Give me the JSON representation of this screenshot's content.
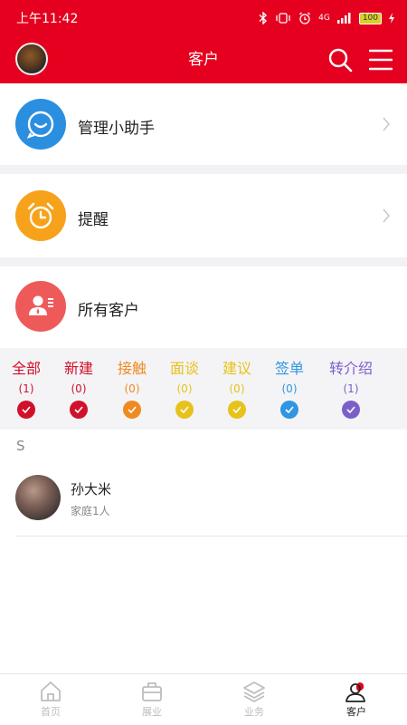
{
  "status_bar": {
    "time": "上午11:42",
    "signal": "4G",
    "battery": "100"
  },
  "header": {
    "title": "客户"
  },
  "items": [
    {
      "label": "管理小助手",
      "icon": "chat-bubble-icon",
      "color": "#2b8fe0"
    },
    {
      "label": "提醒",
      "icon": "alarm-clock-icon",
      "color": "#f7a21b"
    },
    {
      "label": "所有客户",
      "icon": "customer-card-icon",
      "color": "#ee5a5a"
    }
  ],
  "filters": [
    {
      "label": "全部",
      "count": "(1)",
      "color": "#d0112b"
    },
    {
      "label": "新建",
      "count": "(0)",
      "color": "#d0112b"
    },
    {
      "label": "接触",
      "count": "(0)",
      "color": "#ef8a20"
    },
    {
      "label": "面谈",
      "count": "(0)",
      "color": "#e7c21c"
    },
    {
      "label": "建议",
      "count": "(0)",
      "color": "#e7c21c"
    },
    {
      "label": "签单",
      "count": "(0)",
      "color": "#3196e1"
    },
    {
      "label": "转介绍",
      "count": "(1)",
      "color": "#7b5fc9"
    }
  ],
  "section_letter": "S",
  "customers": [
    {
      "name": "孙大米",
      "detail": "家庭1人"
    }
  ],
  "tabs": [
    {
      "label": "首页",
      "icon": "home-icon"
    },
    {
      "label": "展业",
      "icon": "briefcase-icon"
    },
    {
      "label": "业务",
      "icon": "layers-icon"
    },
    {
      "label": "客户",
      "icon": "customer-icon",
      "active": true
    }
  ]
}
